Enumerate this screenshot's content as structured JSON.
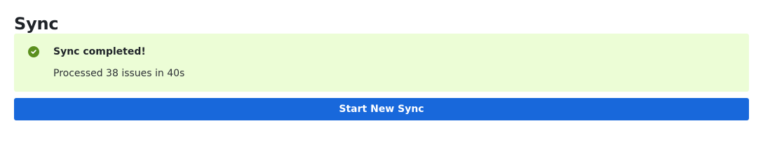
{
  "page": {
    "title": "Sync"
  },
  "alert": {
    "status": "success",
    "icon": "check-circle-icon",
    "title": "Sync completed!",
    "message": "Processed 38 issues in 40s",
    "background_color": "#ecfdd6",
    "icon_color": "#5b8f1e"
  },
  "actions": {
    "start_new_sync_label": "Start New Sync",
    "button_color": "#1868db"
  }
}
